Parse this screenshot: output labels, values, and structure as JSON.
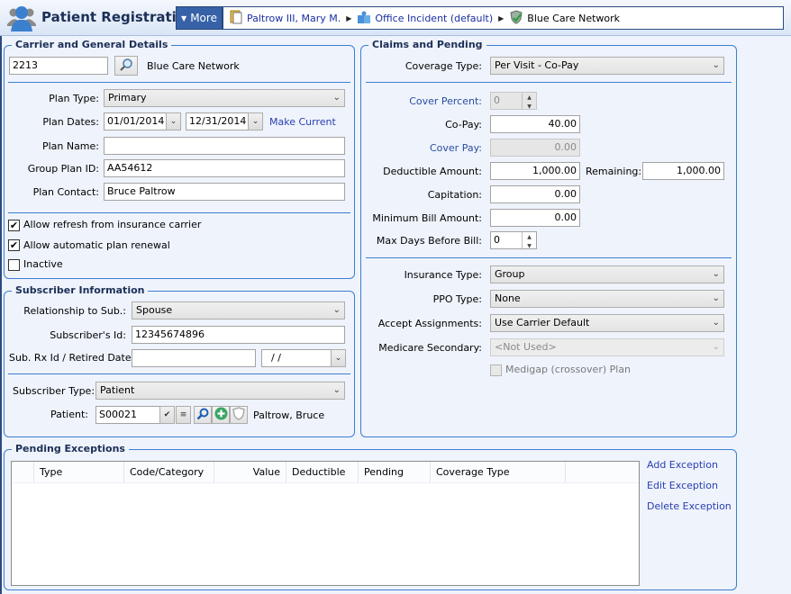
{
  "header": {
    "title": "Patient Registration",
    "more_label": "More",
    "breadcrumb": [
      {
        "label": "Paltrow III, Mary M.",
        "icon": "patient-file-icon"
      },
      {
        "label": "Office Incident (default)",
        "icon": "case-puzzle-icon"
      },
      {
        "label": "Blue Care Network",
        "icon": "insurance-shield-icon"
      }
    ]
  },
  "carrier": {
    "title": "Carrier and General Details",
    "carrier_code": "2213",
    "carrier_name": "Blue Care Network",
    "plan_type_label": "Plan Type:",
    "plan_type": "Primary",
    "plan_dates_label": "Plan Dates:",
    "plan_start": "01/01/2014",
    "plan_end": "12/31/2014",
    "make_current": "Make Current",
    "plan_name_label": "Plan Name:",
    "plan_name": "",
    "group_plan_id_label": "Group Plan ID:",
    "group_plan_id": "AA54612",
    "plan_contact_label": "Plan Contact:",
    "plan_contact": "Bruce Paltrow",
    "allow_refresh_label": "Allow refresh from insurance carrier",
    "allow_refresh": true,
    "allow_renewal_label": "Allow automatic plan renewal",
    "allow_renewal": true,
    "inactive_label": "Inactive",
    "inactive": false
  },
  "subscriber": {
    "title": "Subscriber Information",
    "relationship_label": "Relationship to Sub.:",
    "relationship": "Spouse",
    "sub_id_label": "Subscriber's Id:",
    "sub_id": "12345674896",
    "rx_label": "Sub. Rx Id / Retired Date:",
    "rx_id": "",
    "retired_date": "/ /",
    "sub_type_label": "Subscriber Type:",
    "sub_type": "Patient",
    "patient_label": "Patient:",
    "patient_code": "S00021",
    "patient_name": "Paltrow, Bruce"
  },
  "claims": {
    "title": "Claims and Pending",
    "coverage_type_label": "Coverage Type:",
    "coverage_type": "Per Visit - Co-Pay",
    "cover_percent_label": "Cover Percent:",
    "cover_percent": "0",
    "copay_label": "Co-Pay:",
    "copay": "40.00",
    "cover_pay_label": "Cover Pay:",
    "cover_pay": "0.00",
    "deductible_label": "Deductible Amount:",
    "deductible": "1,000.00",
    "remaining_label": "Remaining:",
    "remaining": "1,000.00",
    "capitation_label": "Capitation:",
    "capitation": "0.00",
    "min_bill_label": "Minimum Bill Amount:",
    "min_bill": "0.00",
    "max_days_label": "Max Days Before Bill:",
    "max_days": "0",
    "insurance_type_label": "Insurance Type:",
    "insurance_type": "Group",
    "ppo_type_label": "PPO Type:",
    "ppo_type": "None",
    "accept_label": "Accept Assignments:",
    "accept": "Use Carrier Default",
    "medicare_label": "Medicare Secondary:",
    "medicare": "<Not Used>",
    "medigap_label": "Medigap (crossover) Plan",
    "medigap": false
  },
  "pending": {
    "title": "Pending Exceptions",
    "columns": [
      "",
      "Type",
      "Code/Category",
      "Value",
      "Deductible",
      "Pending",
      "Coverage Type",
      ""
    ],
    "rows": [],
    "add_label": "Add Exception",
    "edit_label": "Edit Exception",
    "delete_label": "Delete Exception"
  }
}
